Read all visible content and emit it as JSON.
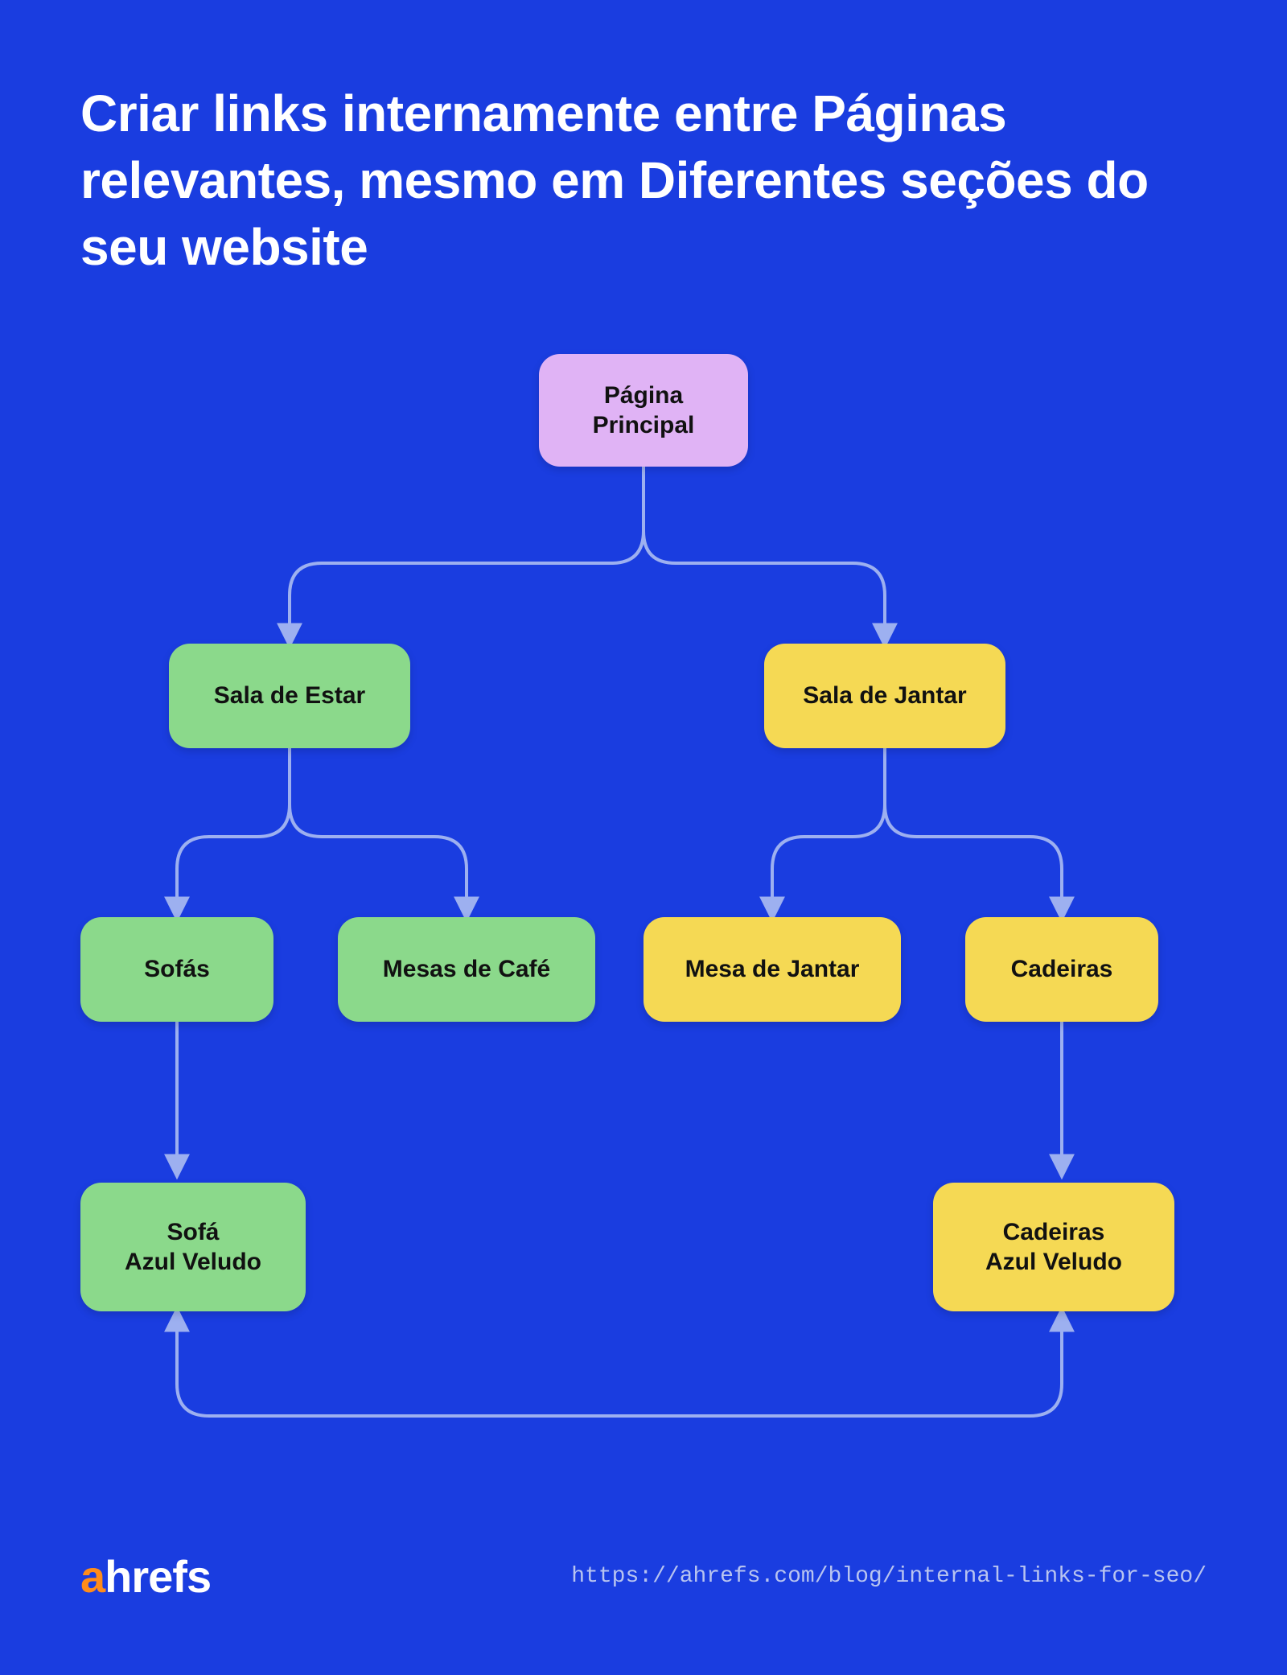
{
  "title": "Criar links internamente entre Páginas relevantes, mesmo em Diferentes seções do seu website",
  "nodes": {
    "root": "Página\nPrincipal",
    "living_room": "Sala de Estar",
    "dining_room": "Sala de Jantar",
    "sofas": "Sofás",
    "coffee_tables": "Mesas de Café",
    "dining_table": "Mesa de Jantar",
    "chairs": "Cadeiras",
    "blue_velvet_sofa": "Sofá\nAzul Veludo",
    "blue_velvet_chairs": "Cadeiras\nAzul Veludo"
  },
  "colors": {
    "purple": "#e0b3f5",
    "green": "#8bd98b",
    "yellow": "#f5d954",
    "bg": "#1a3de0",
    "connector": "#9db0f0"
  },
  "footer": {
    "brand_a": "a",
    "brand_rest": "hrefs",
    "url": "https://ahrefs.com/blog/internal-links-for-seo/"
  },
  "chart_data": {
    "type": "tree",
    "title": "Internal linking site structure",
    "nodes": [
      {
        "id": "root",
        "label": "Página Principal",
        "color": "purple"
      },
      {
        "id": "living_room",
        "label": "Sala de Estar",
        "color": "green"
      },
      {
        "id": "dining_room",
        "label": "Sala de Jantar",
        "color": "yellow"
      },
      {
        "id": "sofas",
        "label": "Sofás",
        "color": "green"
      },
      {
        "id": "coffee_tables",
        "label": "Mesas de Café",
        "color": "green"
      },
      {
        "id": "dining_table",
        "label": "Mesa de Jantar",
        "color": "yellow"
      },
      {
        "id": "chairs",
        "label": "Cadeiras",
        "color": "yellow"
      },
      {
        "id": "blue_velvet_sofa",
        "label": "Sofá Azul Veludo",
        "color": "green"
      },
      {
        "id": "blue_velvet_chairs",
        "label": "Cadeiras Azul Veludo",
        "color": "yellow"
      }
    ],
    "edges": [
      {
        "from": "root",
        "to": "living_room"
      },
      {
        "from": "root",
        "to": "dining_room"
      },
      {
        "from": "living_room",
        "to": "sofas"
      },
      {
        "from": "living_room",
        "to": "coffee_tables"
      },
      {
        "from": "dining_room",
        "to": "dining_table"
      },
      {
        "from": "dining_room",
        "to": "chairs"
      },
      {
        "from": "sofas",
        "to": "blue_velvet_sofa"
      },
      {
        "from": "chairs",
        "to": "blue_velvet_chairs"
      },
      {
        "from": "blue_velvet_sofa",
        "to": "blue_velvet_chairs",
        "bidirectional": true
      }
    ]
  }
}
